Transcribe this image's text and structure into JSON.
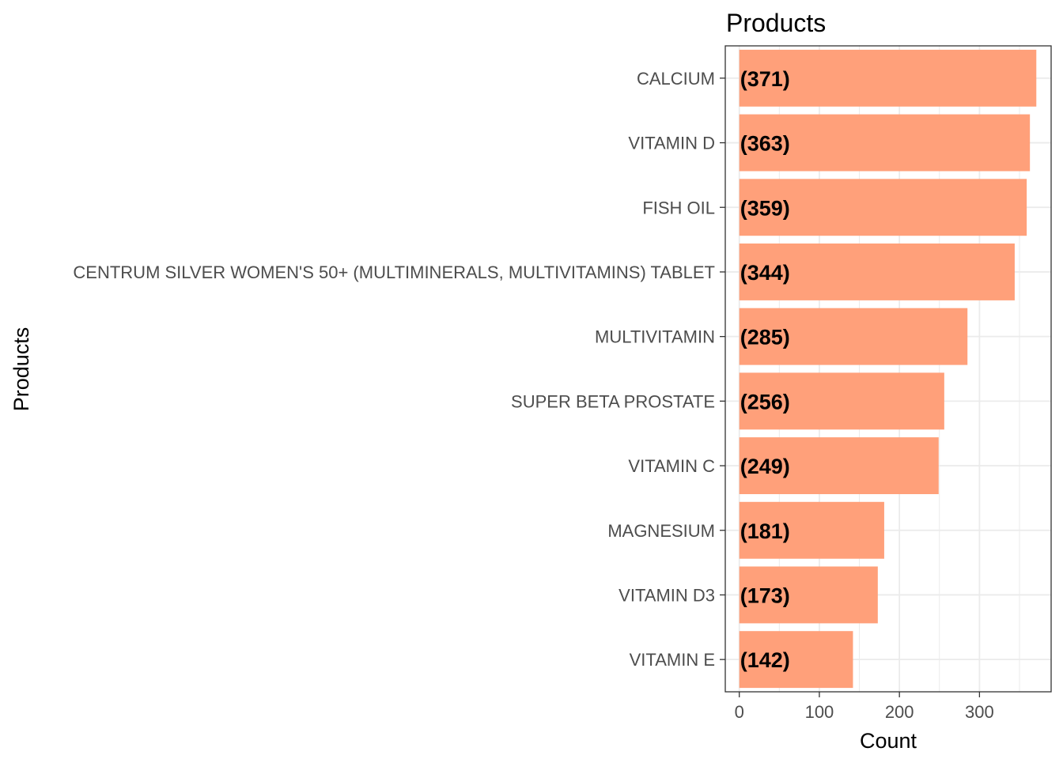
{
  "chart_data": {
    "type": "bar",
    "orientation": "horizontal",
    "title": "Products",
    "xlabel": "Count",
    "ylabel": "Products",
    "categories": [
      "CALCIUM",
      "VITAMIN D",
      "FISH OIL",
      "CENTRUM SILVER WOMEN'S 50+ (MULTIMINERALS, MULTIVITAMINS) TABLET",
      "MULTIVITAMIN",
      "SUPER BETA PROSTATE",
      "VITAMIN C",
      "MAGNESIUM",
      "VITAMIN D3",
      "VITAMIN E"
    ],
    "values": [
      371,
      363,
      359,
      344,
      285,
      256,
      249,
      181,
      173,
      142
    ],
    "data_labels": [
      "(371)",
      "(363)",
      "(359)",
      "(344)",
      "(285)",
      "(256)",
      "(249)",
      "(181)",
      "(173)",
      "(142)"
    ],
    "xticks": [
      0,
      100,
      200,
      300
    ],
    "xtick_labels": [
      "0",
      "100",
      "200",
      "300"
    ],
    "xlim": [
      -17.5,
      389.5
    ],
    "grid": true,
    "bar_color": "#ffa07a",
    "grid_color": "#ebebeb",
    "panel_border_color": "#333333"
  }
}
